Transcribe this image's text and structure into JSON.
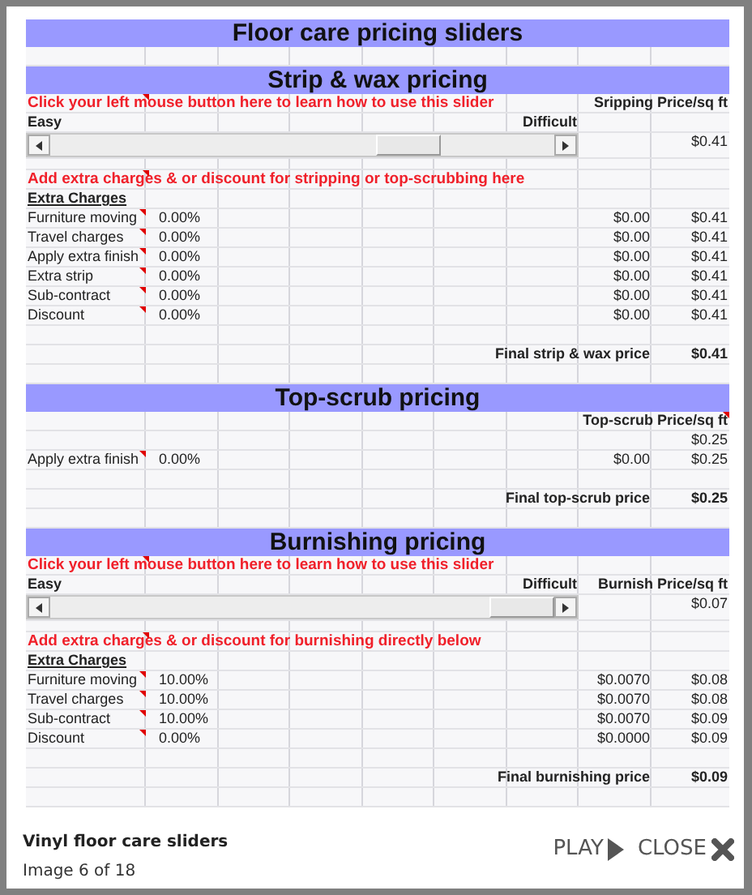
{
  "rows": [
    {
      "kind": "band",
      "text": "Floor care pricing sliders"
    },
    {
      "kind": "blank"
    },
    {
      "kind": "band",
      "text": "Strip & wax pricing"
    },
    {
      "kind": "note",
      "text": "Click your left mouse button here to learn how to use this slider",
      "comment": true,
      "header": "Sripping Price/sq ft"
    },
    {
      "kind": "scale",
      "left": "Easy",
      "right": "Difficult"
    },
    {
      "kind": "slider",
      "level": 0.74,
      "value": "$0.41"
    },
    {
      "kind": "gap"
    },
    {
      "kind": "note",
      "text": "Add extra charges & or discount for stripping or top-scrubbing here",
      "comment": true
    },
    {
      "kind": "heading",
      "text": "Extra Charges"
    },
    {
      "kind": "charge",
      "label": "Furniture moving",
      "comment": true,
      "percent": "0.00%",
      "amount": "$0.00",
      "price": "$0.41"
    },
    {
      "kind": "charge",
      "label": "Travel charges",
      "comment": true,
      "percent": "0.00%",
      "amount": "$0.00",
      "price": "$0.41"
    },
    {
      "kind": "charge",
      "label": "Apply extra finish",
      "comment": true,
      "percent": "0.00%",
      "amount": "$0.00",
      "price": "$0.41"
    },
    {
      "kind": "charge",
      "label": "Extra strip",
      "comment": true,
      "percent": "0.00%",
      "amount": "$0.00",
      "price": "$0.41"
    },
    {
      "kind": "charge",
      "label": "Sub-contract",
      "comment": true,
      "percent": "0.00%",
      "amount": "$0.00",
      "price": "$0.41"
    },
    {
      "kind": "charge",
      "label": "Discount",
      "comment": true,
      "percent": "0.00%",
      "amount": "$0.00",
      "price": "$0.41"
    },
    {
      "kind": "blank"
    },
    {
      "kind": "total",
      "label": "Final strip & wax price",
      "value": "$0.41"
    },
    {
      "kind": "blank"
    },
    {
      "kind": "band",
      "text": "Top-scrub pricing"
    },
    {
      "kind": "header",
      "text": "Top-scrub Price/sq ft",
      "comment": true
    },
    {
      "kind": "value",
      "value": "$0.25"
    },
    {
      "kind": "charge",
      "label": "Apply extra finish",
      "comment": true,
      "percent": "0.00%",
      "amount": "$0.00",
      "price": "$0.25"
    },
    {
      "kind": "blank"
    },
    {
      "kind": "total",
      "label": "Final top-scrub price",
      "value": "$0.25"
    },
    {
      "kind": "blank"
    },
    {
      "kind": "band",
      "text": "Burnishing pricing"
    },
    {
      "kind": "note",
      "text": "Click your left mouse button here to learn how to use this slider",
      "comment": true
    },
    {
      "kind": "scale",
      "left": "Easy",
      "right": "Difficult",
      "header": "Burnish Price/sq ft"
    },
    {
      "kind": "slider",
      "level": 1,
      "value": "$0.07"
    },
    {
      "kind": "gap"
    },
    {
      "kind": "note",
      "text": "Add extra charges & or discount for burnishing directly below",
      "comment": true
    },
    {
      "kind": "heading",
      "text": "Extra Charges"
    },
    {
      "kind": "charge",
      "label": "Furniture moving",
      "comment": true,
      "percent": "10.00%",
      "amount": "$0.0070",
      "price": "$0.08"
    },
    {
      "kind": "charge",
      "label": "Travel charges",
      "comment": true,
      "percent": "10.00%",
      "amount": "$0.0070",
      "price": "$0.08"
    },
    {
      "kind": "charge",
      "label": "Sub-contract",
      "comment": true,
      "percent": "10.00%",
      "amount": "$0.0070",
      "price": "$0.09"
    },
    {
      "kind": "charge",
      "label": "Discount",
      "comment": true,
      "percent": "0.00%",
      "amount": "$0.0000",
      "price": "$0.09"
    },
    {
      "kind": "blank"
    },
    {
      "kind": "total",
      "label": "Final burnishing price",
      "value": "$0.09"
    },
    {
      "kind": "blank"
    }
  ],
  "caption": {
    "title": "Vinyl floor care sliders",
    "counter": "Image 6 of 18"
  },
  "controls": {
    "play": "PLAY",
    "close": "CLOSE"
  }
}
